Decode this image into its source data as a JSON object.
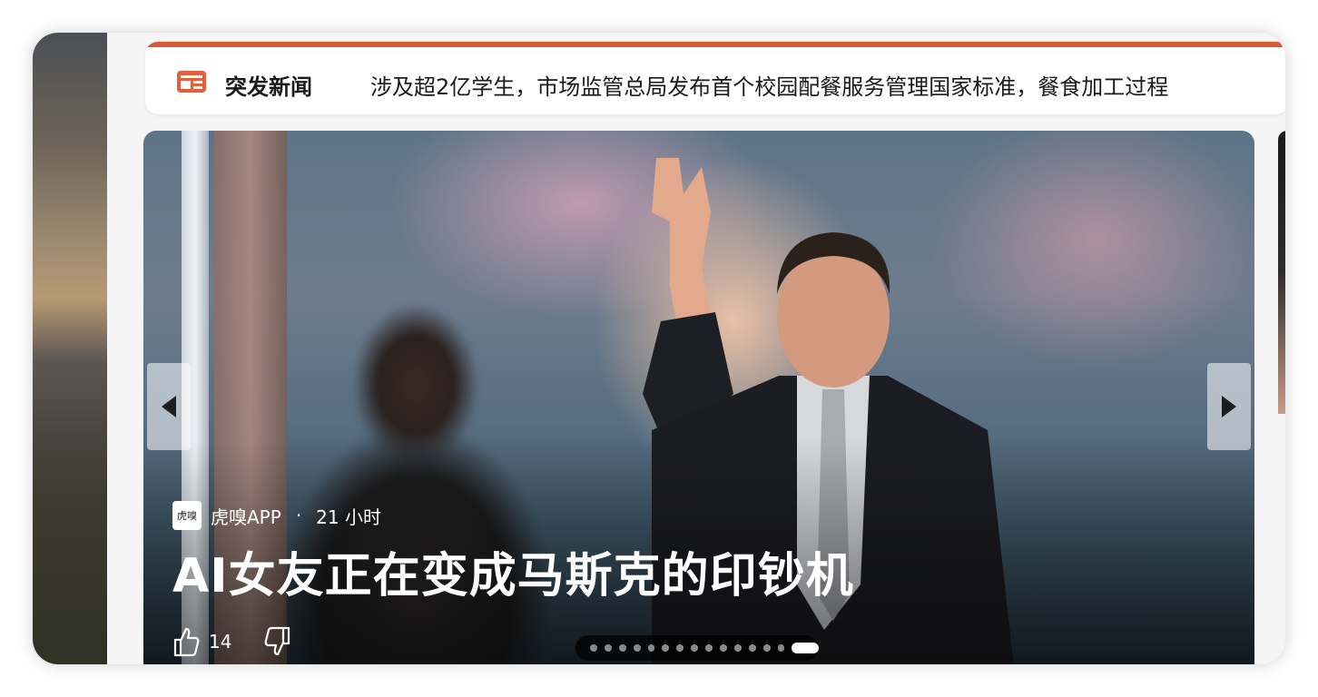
{
  "news_bar": {
    "icon": "newspaper-icon",
    "label": "突发新闻",
    "headline": "涉及超2亿学生，市场监管总局发布首个校园配餐服务管理国家标准，餐食加工过程",
    "accent_color": "#d9593c"
  },
  "carousel": {
    "source": {
      "logo_text": "虎嗅",
      "name": "虎嗅APP",
      "separator": "·",
      "time": "21 小时"
    },
    "headline": "AI女友正在变成马斯克的印钞机",
    "likes": "14",
    "slide_count": 15,
    "active_slide": 15
  }
}
